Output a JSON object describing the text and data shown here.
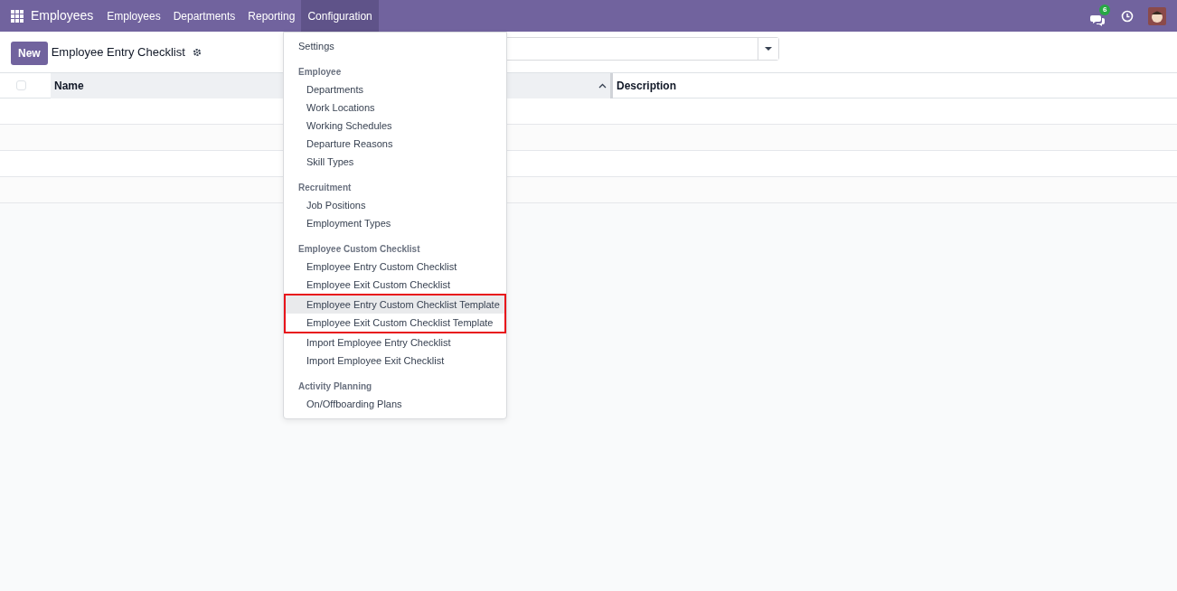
{
  "navbar": {
    "app_name": "Employees",
    "menus": [
      {
        "label": "Employees",
        "selected": false
      },
      {
        "label": "Departments",
        "selected": false
      },
      {
        "label": "Reporting",
        "selected": false
      },
      {
        "label": "Configuration",
        "selected": true
      }
    ],
    "messages_count": "6"
  },
  "control_panel": {
    "new_button": "New",
    "title": "Employee Entry Checklist"
  },
  "table": {
    "select_all": {
      "checked": false
    },
    "columns": [
      {
        "label": "Name",
        "sorted": true
      },
      {
        "label": "Description",
        "sorted": false
      }
    ]
  },
  "dropdown": {
    "sections": [
      {
        "items": [
          {
            "label": "Settings",
            "highlighted": false,
            "annotated": false
          }
        ]
      },
      {
        "heading": "Employee",
        "items": [
          {
            "label": "Departments",
            "highlighted": false,
            "annotated": false
          },
          {
            "label": "Work Locations",
            "highlighted": false,
            "annotated": false
          },
          {
            "label": "Working Schedules",
            "highlighted": false,
            "annotated": false
          },
          {
            "label": "Departure Reasons",
            "highlighted": false,
            "annotated": false
          },
          {
            "label": "Skill Types",
            "highlighted": false,
            "annotated": false
          }
        ]
      },
      {
        "heading": "Recruitment",
        "items": [
          {
            "label": "Job Positions",
            "highlighted": false,
            "annotated": false
          },
          {
            "label": "Employment Types",
            "highlighted": false,
            "annotated": false
          }
        ]
      },
      {
        "heading": "Employee Custom Checklist",
        "items": [
          {
            "label": "Employee Entry Custom Checklist",
            "highlighted": false,
            "annotated": false
          },
          {
            "label": "Employee Exit Custom Checklist",
            "highlighted": false,
            "annotated": false
          },
          {
            "label": "Employee Entry Custom Checklist Template",
            "highlighted": true,
            "annotated": true
          },
          {
            "label": "Employee Exit Custom Checklist Template",
            "highlighted": false,
            "annotated": true
          },
          {
            "label": "Import Employee Entry Checklist",
            "highlighted": false,
            "annotated": false
          },
          {
            "label": "Import Employee Exit Checklist",
            "highlighted": false,
            "annotated": false
          }
        ]
      },
      {
        "heading": "Activity Planning",
        "items": [
          {
            "label": "On/Offboarding Plans",
            "highlighted": false,
            "annotated": false
          }
        ]
      }
    ]
  }
}
